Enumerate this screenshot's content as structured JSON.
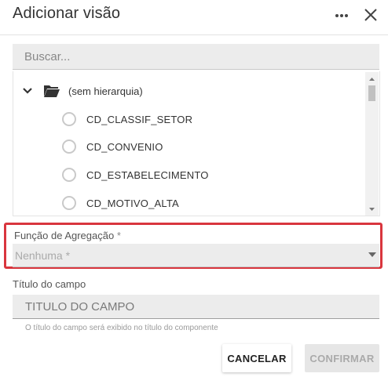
{
  "dialog": {
    "title": "Adicionar visão"
  },
  "header": {
    "more_icon": "more-horizontal-icon",
    "close_icon": "close-icon"
  },
  "search": {
    "placeholder": "Buscar...",
    "value": ""
  },
  "tree": {
    "folder": {
      "label": "(sem hierarquia)",
      "expanded": true
    },
    "items": [
      {
        "label": "CD_CLASSIF_SETOR",
        "selected": false
      },
      {
        "label": "CD_CONVENIO",
        "selected": false
      },
      {
        "label": "CD_ESTABELECIMENTO",
        "selected": false
      },
      {
        "label": "CD_MOTIVO_ALTA",
        "selected": false
      }
    ]
  },
  "aggregation": {
    "label": "Função de Agregação",
    "required_mark": "*",
    "selected_value": "Nenhuma *"
  },
  "field_title": {
    "label": "Título do campo",
    "placeholder": "TITULO DO CAMPO",
    "value": "",
    "helper": "O título do campo será exibido no título do componente"
  },
  "actions": {
    "cancel_label": "CANCELAR",
    "confirm_label": "CONFIRMAR",
    "confirm_enabled": false
  },
  "colors": {
    "highlight_border": "#d9363e",
    "input_background": "#ececec",
    "folder_icon": "#333333"
  }
}
